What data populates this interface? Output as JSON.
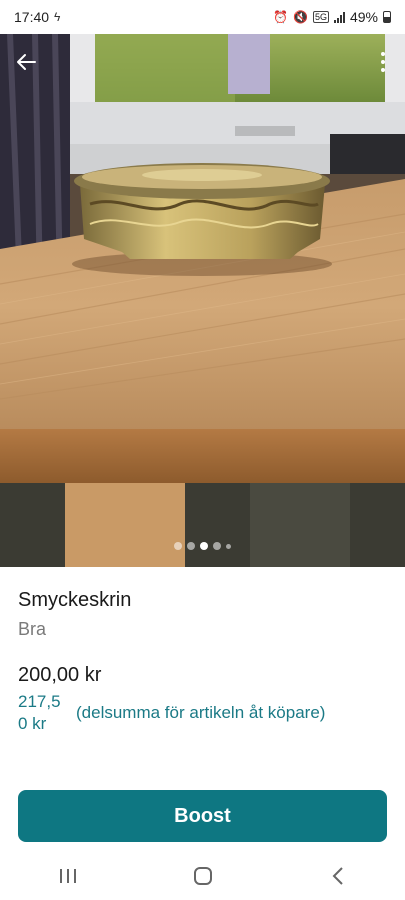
{
  "status_bar": {
    "time": "17:40",
    "battery": "49%",
    "network": "5G"
  },
  "photo": {
    "carousel_count": 5,
    "active_index": 2
  },
  "listing": {
    "title": "Smyckeskrin",
    "condition": "Bra",
    "price": "200,00 kr",
    "buyer_total": "217,50 kr",
    "buyer_note": "(delsumma för artikeln åt köpare)"
  },
  "actions": {
    "boost_label": "Boost"
  },
  "colors": {
    "accent": "#0e7782",
    "link_teal": "#1b7a86"
  },
  "icons": {
    "back": "arrow-left-icon",
    "more": "more-vert-icon",
    "nav_recents": "recents-icon",
    "nav_home": "home-icon",
    "nav_back": "chevron-left-icon"
  }
}
